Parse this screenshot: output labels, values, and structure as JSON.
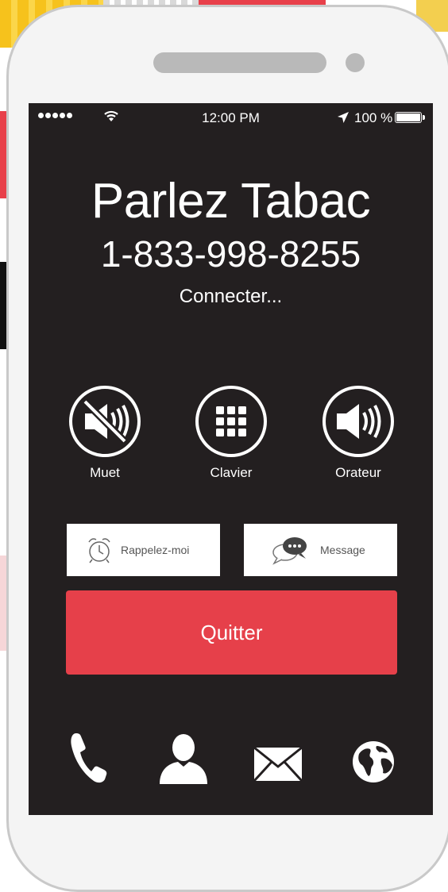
{
  "status_bar": {
    "time": "12:00 PM",
    "battery": "100 %"
  },
  "call": {
    "name": "Parlez Tabac",
    "number": "1-833-998-8255",
    "status": "Connecter..."
  },
  "controls": [
    {
      "label": "Muet",
      "icon": "speaker-muted-icon"
    },
    {
      "label": "Clavier",
      "icon": "keypad-icon"
    },
    {
      "label": "Orateur",
      "icon": "speaker-icon"
    }
  ],
  "secondary_actions": [
    {
      "label": "Rappelez-moi",
      "icon": "alarm-clock-icon"
    },
    {
      "label": "Message",
      "icon": "chat-bubble-icon"
    }
  ],
  "end_call": {
    "label": "Quitter",
    "color": "#e6404a"
  },
  "dock": [
    "phone-icon",
    "contacts-icon",
    "mail-icon",
    "globe-icon"
  ],
  "colors": {
    "screen": "#231f20",
    "accent": "#e6404a"
  }
}
